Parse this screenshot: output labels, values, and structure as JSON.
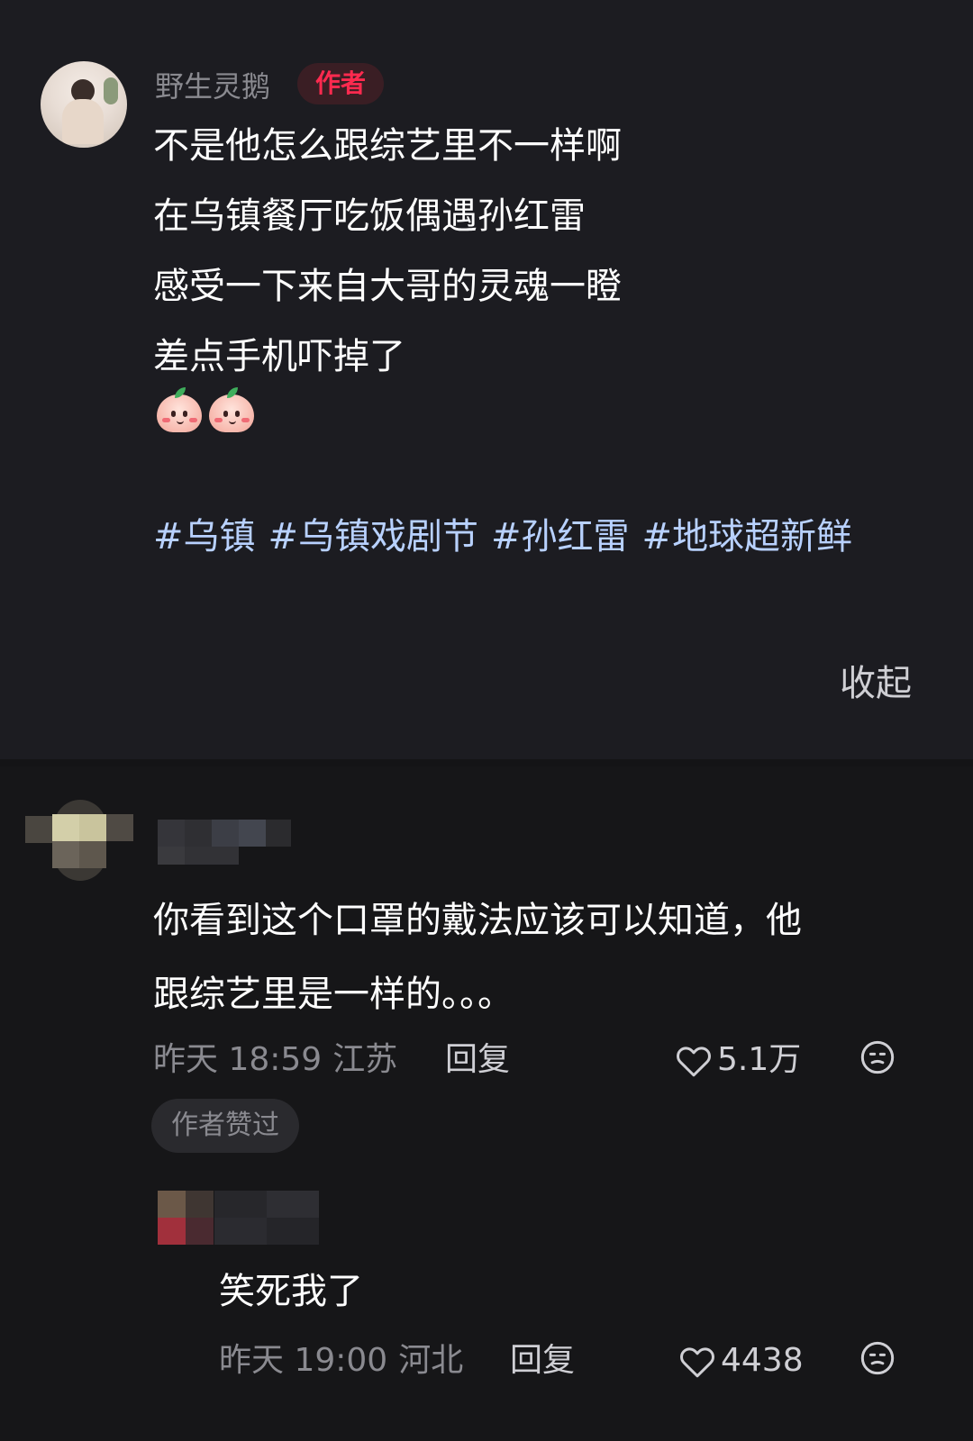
{
  "post": {
    "author_name": "野生灵鹅",
    "author_badge": "作者",
    "lines": [
      "不是他怎么跟综艺里不一样啊",
      "在乌镇餐厅吃饭偶遇孙红雷",
      "感受一下来自大哥的灵魂一瞪",
      "差点手机吓掉了"
    ],
    "emojis": [
      "peach-face-emoji",
      "peach-face-emoji"
    ],
    "hashtags": [
      "#乌镇",
      "#乌镇戏剧节",
      "#孙红雷",
      "#地球超新鲜"
    ],
    "collapse_label": "收起"
  },
  "comments": [
    {
      "text_lines": [
        "你看到这个口罩的戴法应该可以知道，他",
        "跟综艺里是一样的。。。"
      ],
      "time": "昨天 18:59",
      "region": "江苏",
      "reply_label": "回复",
      "likes": "5.1万",
      "author_liked_badge": "作者赞过"
    },
    {
      "text": "笑死我了",
      "time": "昨天 19:00",
      "region": "河北",
      "reply_label": "回复",
      "likes": "4438"
    }
  ],
  "colors": {
    "background": "#151517",
    "card": "#1c1c21",
    "accent_red": "#ff2a4f",
    "hashtag": "#b8d1ff",
    "muted": "#8a8a90"
  },
  "icons": [
    "heart-outline-icon",
    "dislike-face-icon"
  ]
}
